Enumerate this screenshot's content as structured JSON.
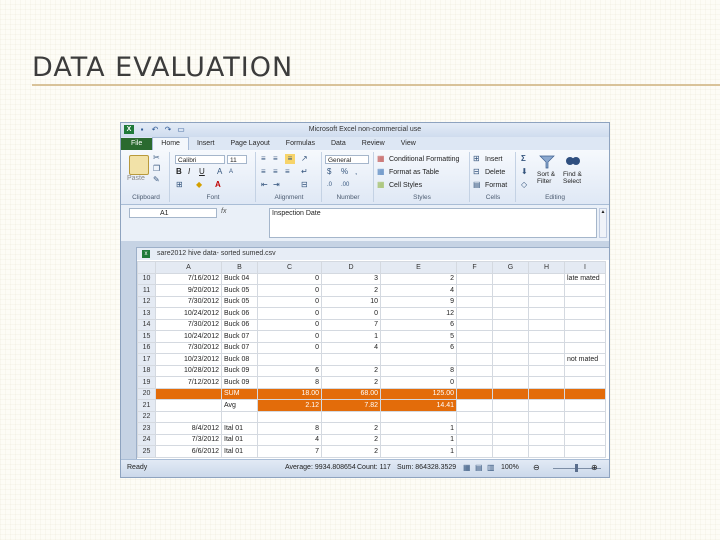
{
  "slide": {
    "title": "DATA EVALUATION"
  },
  "window": {
    "title": "Microsoft Excel non-commercial use",
    "tabs": [
      "File",
      "Home",
      "Insert",
      "Page Layout",
      "Formulas",
      "Data",
      "Review",
      "View"
    ]
  },
  "ribbon": {
    "clipboard": {
      "paste": "Paste",
      "label": "Clipboard"
    },
    "font": {
      "name": "Calibri",
      "size": "11",
      "label": "Font"
    },
    "alignment": {
      "label": "Alignment"
    },
    "number": {
      "format": "General",
      "currency": "$",
      "percent": "%",
      "comma": ",",
      "label": "Number"
    },
    "styles": {
      "conditional": "Conditional Formatting",
      "format_table": "Format as Table",
      "cell_styles": "Cell Styles",
      "label": "Styles"
    },
    "cells": {
      "insert": "Insert",
      "delete": "Delete",
      "format": "Format",
      "label": "Cells"
    },
    "editing": {
      "sort": "Sort & Filter",
      "find": "Find & Select",
      "label": "Editing"
    }
  },
  "formula_bar": {
    "name_box": "A1",
    "fx": "fx",
    "content": "Inspection Date"
  },
  "workbook": {
    "title": "sare2012 hive data- sorted sumed.csv"
  },
  "sheet": {
    "columns": [
      "A",
      "B",
      "C",
      "D",
      "E",
      "F",
      "G",
      "H",
      "I"
    ],
    "rows": [
      {
        "n": "10",
        "a": "7/16/2012",
        "b": "Buck 04",
        "c": "0",
        "d": "3",
        "e": "2",
        "i": "late mated"
      },
      {
        "n": "11",
        "a": "9/20/2012",
        "b": "Buck 05",
        "c": "0",
        "d": "2",
        "e": "4",
        "i": ""
      },
      {
        "n": "12",
        "a": "7/30/2012",
        "b": "Buck 05",
        "c": "0",
        "d": "10",
        "e": "9",
        "i": ""
      },
      {
        "n": "13",
        "a": "10/24/2012",
        "b": "Buck 06",
        "c": "0",
        "d": "0",
        "e": "12",
        "i": ""
      },
      {
        "n": "14",
        "a": "7/30/2012",
        "b": "Buck 06",
        "c": "0",
        "d": "7",
        "e": "6",
        "i": ""
      },
      {
        "n": "15",
        "a": "10/24/2012",
        "b": "Buck 07",
        "c": "0",
        "d": "1",
        "e": "5",
        "i": ""
      },
      {
        "n": "16",
        "a": "7/30/2012",
        "b": "Buck 07",
        "c": "0",
        "d": "4",
        "e": "6",
        "i": ""
      },
      {
        "n": "17",
        "a": "10/23/2012",
        "b": "Buck 08",
        "c": "",
        "d": "",
        "e": "",
        "i": "not mated"
      },
      {
        "n": "18",
        "a": "10/28/2012",
        "b": "Buck 09",
        "c": "6",
        "d": "2",
        "e": "8",
        "i": ""
      },
      {
        "n": "19",
        "a": "7/12/2012",
        "b": "Buck 09",
        "c": "8",
        "d": "2",
        "e": "0",
        "i": ""
      },
      {
        "n": "20",
        "a": "",
        "b": "SUM",
        "c": "18.00",
        "d": "68.00",
        "e": "125.00",
        "i": ""
      },
      {
        "n": "21",
        "a": "",
        "b": "Avg",
        "c": "2.12",
        "d": "7.82",
        "e": "14.41",
        "i": ""
      },
      {
        "n": "22",
        "a": "",
        "b": "",
        "c": "",
        "d": "",
        "e": "",
        "i": ""
      },
      {
        "n": "23",
        "a": "8/4/2012",
        "b": "Ital 01",
        "c": "8",
        "d": "2",
        "e": "1",
        "i": ""
      },
      {
        "n": "24",
        "a": "7/3/2012",
        "b": "Ital 01",
        "c": "4",
        "d": "2",
        "e": "1",
        "i": ""
      },
      {
        "n": "25",
        "a": "6/6/2012",
        "b": "Ital 01",
        "c": "7",
        "d": "2",
        "e": "1",
        "i": ""
      }
    ],
    "highlight_color": "#e36c0a"
  },
  "status_bar": {
    "ready": "Ready",
    "average": "Average: 9934.808654",
    "count": "Count: 117",
    "sum": "Sum: 864328.3529",
    "zoom": "100%"
  }
}
